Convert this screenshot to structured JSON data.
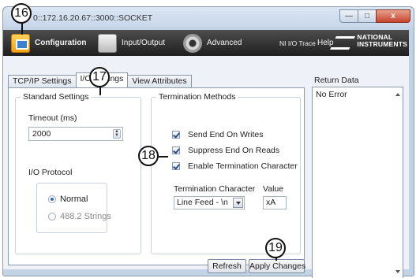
{
  "window": {
    "title": "0::172.16.20.67::3000::SOCKET",
    "close_symbol": "x"
  },
  "toolbar": {
    "items": [
      {
        "label": "Configuration",
        "icon": "configuration-icon"
      },
      {
        "label": "Input/Output",
        "icon": "input-output-icon"
      },
      {
        "label": "Advanced",
        "icon": "advanced-gear-icon"
      },
      {
        "label": "NI I/O Trace"
      },
      {
        "label": "Help"
      }
    ],
    "logo_line1": "NATIONAL",
    "logo_line2": "INSTRUMENTS"
  },
  "tabs": [
    {
      "label": "TCP/IP Settings",
      "active": false
    },
    {
      "label": "I/O Settings",
      "active": true
    },
    {
      "label": "View Attributes",
      "active": false
    }
  ],
  "standard_settings": {
    "title": "Standard Settings",
    "timeout_label": "Timeout (ms)",
    "timeout_value": "2000",
    "io_protocol_label": "I/O Protocol",
    "protocols": [
      {
        "label": "Normal",
        "selected": true
      },
      {
        "label": "488.2 Strings",
        "selected": false
      }
    ]
  },
  "termination": {
    "title": "Termination Methods",
    "options": [
      {
        "label": "Send End On Writes",
        "checked": true
      },
      {
        "label": "Suppress End On Reads",
        "checked": true
      },
      {
        "label": "Enable Termination Character",
        "checked": true
      }
    ],
    "char_label": "Termination Character",
    "char_value": "Line Feed - \\n",
    "value_label": "Value",
    "value": "xA"
  },
  "buttons": {
    "refresh": "Refresh",
    "apply": "Apply Changes"
  },
  "return_data": {
    "label": "Return Data",
    "value": "No Error"
  },
  "callouts": [
    "16",
    "17",
    "18",
    "19"
  ]
}
